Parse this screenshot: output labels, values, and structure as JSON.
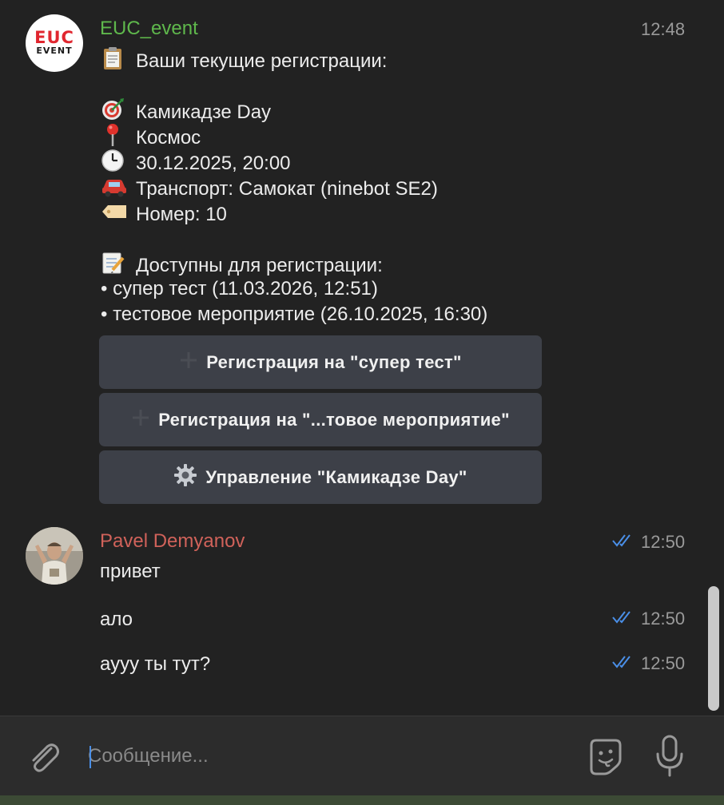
{
  "messages": {
    "bot": {
      "avatar_line1": "EUC",
      "avatar_line2": "EVENT",
      "sender": "EUC_event",
      "time": "12:48",
      "lines": [
        "Ваши текущие регистрации:",
        "Камикадзе Day",
        "Космос",
        "30.12.2025, 20:00",
        "Транспорт: Самокат (ninebot SE2)",
        "Номер: 10",
        "Доступны для регистрации:",
        "• супер тест (11.03.2026, 12:51)",
        "• тестовое мероприятие (26.10.2025, 16:30)"
      ],
      "buttons": [
        {
          "icon": "plus-icon",
          "label": "Регистрация на \"супер тест\""
        },
        {
          "icon": "plus-icon",
          "label": "Регистрация на \"...товое мероприятие\""
        },
        {
          "icon": "gear-icon",
          "label": "Управление \"Камикадзе Day\""
        }
      ]
    },
    "user": {
      "sender": "Pavel Demyanov",
      "items": [
        {
          "text": "привет",
          "time": "12:50",
          "status": "read"
        },
        {
          "text": "ало",
          "time": "12:50",
          "status": "read"
        },
        {
          "text": "аууу ты тут?",
          "time": "12:50",
          "status": "read"
        }
      ]
    }
  },
  "composer": {
    "placeholder": "Сообщение..."
  },
  "colors": {
    "background": "#222222",
    "bot_name": "#5fb84c",
    "user_name": "#d0625a",
    "read_check": "#4a8fe8",
    "button_bg": "#3d4048"
  }
}
